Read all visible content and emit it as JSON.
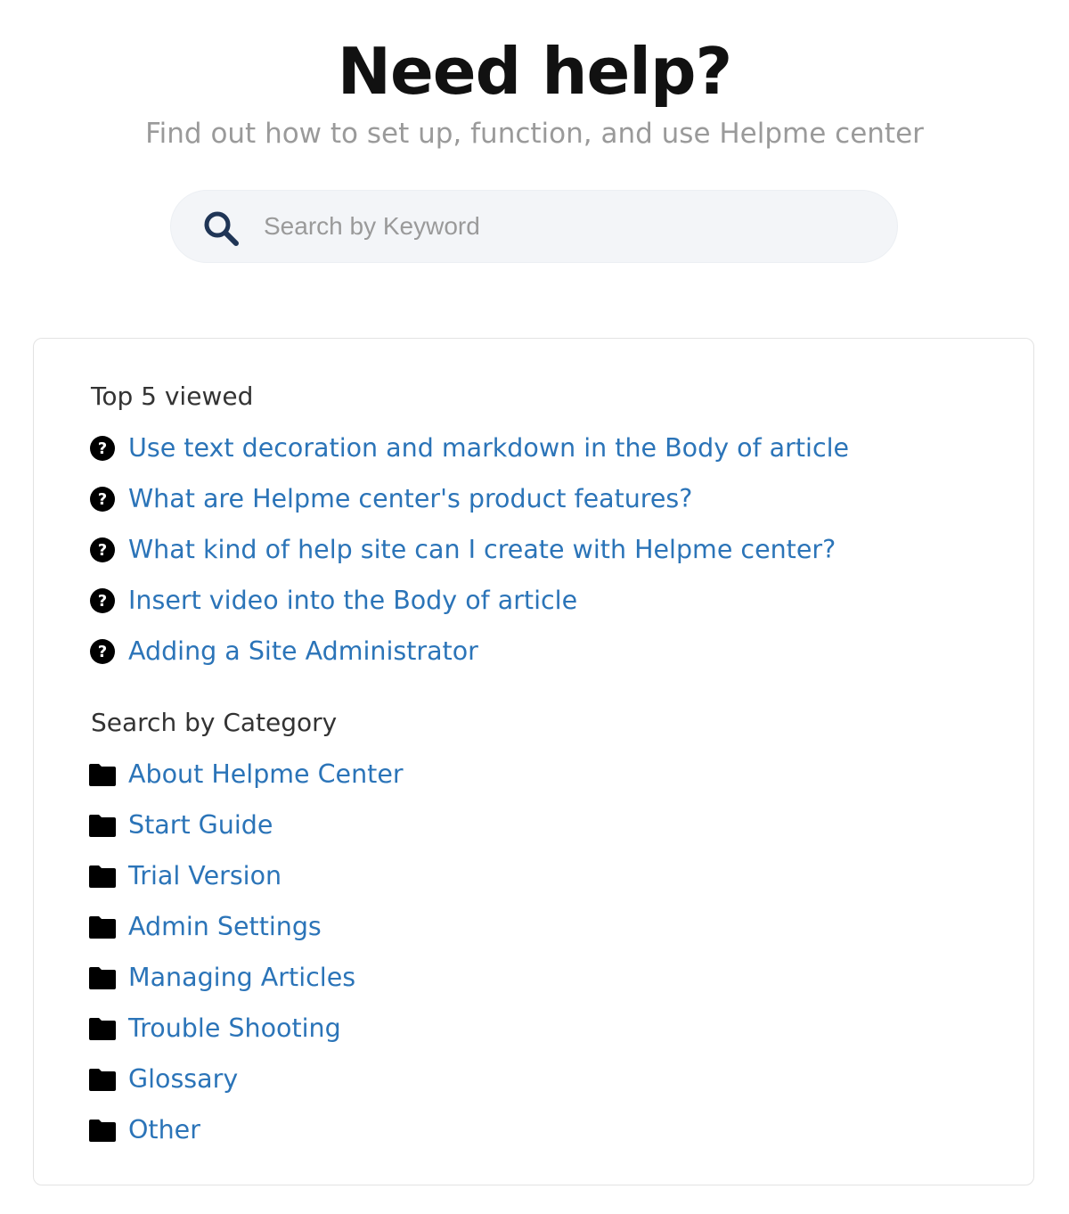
{
  "hero": {
    "title": "Need help?",
    "subtitle": "Find out how to set up, function, and use Helpme center"
  },
  "search": {
    "icon": "search-icon",
    "placeholder": "Search by Keyword",
    "value": ""
  },
  "top_viewed": {
    "heading": "Top 5 viewed",
    "icon": "question-circle-icon",
    "items": [
      {
        "label": "Use text decoration and markdown in the Body of article"
      },
      {
        "label": "What are Helpme center's product features?"
      },
      {
        "label": "What kind of help site can I create with Helpme center?"
      },
      {
        "label": "Insert video into the Body of article"
      },
      {
        "label": "Adding a Site Administrator"
      }
    ]
  },
  "categories": {
    "heading": "Search by Category",
    "icon": "folder-icon",
    "items": [
      {
        "label": "About Helpme Center"
      },
      {
        "label": "Start Guide"
      },
      {
        "label": "Trial Version"
      },
      {
        "label": "Admin Settings"
      },
      {
        "label": "Managing Articles"
      },
      {
        "label": "Trouble Shooting"
      },
      {
        "label": "Glossary"
      },
      {
        "label": "Other"
      }
    ]
  },
  "colors": {
    "link": "#2b74b8",
    "heading": "#333333",
    "muted": "#9a9a9a",
    "search_bg": "#f3f5f8",
    "icon_search": "#1f3556"
  }
}
